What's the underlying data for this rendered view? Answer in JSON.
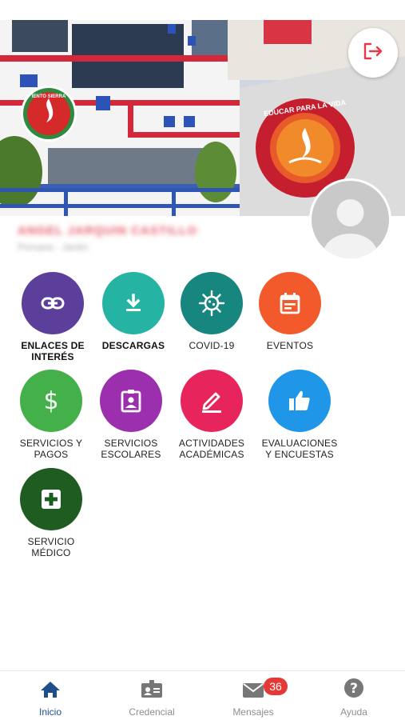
{
  "profile": {
    "name": "ANGEL JARQUIN CASTILLO",
    "level": "Primaria - Jardín"
  },
  "hero": {
    "badge_text": "EDUCAR PARA LA VIDA",
    "logo_text": "IENTO SIERRA"
  },
  "tiles": [
    {
      "label": "ENLACES DE\nINTERÉS",
      "color": "#5b3f9a",
      "icon": "link-icon"
    },
    {
      "label": "DESCARGAS",
      "color": "#25b3a3",
      "icon": "download-icon"
    },
    {
      "label": "COVID-19",
      "color": "#16867f",
      "icon": "virus-icon"
    },
    {
      "label": "EVENTOS",
      "color": "#f2592b",
      "icon": "calendar-icon"
    },
    {
      "label": "SERVICIOS Y\nPAGOS",
      "color": "#43b04a",
      "icon": "dollar-icon"
    },
    {
      "label": "SERVICIOS\nESCOLARES",
      "color": "#9b2fae",
      "icon": "id-badge-icon"
    },
    {
      "label": "ACTIVIDADES\nACADÉMICAS",
      "color": "#e8245c",
      "icon": "pencil-icon"
    },
    {
      "label": "EVALUACIONES\nY ENCUESTAS",
      "color": "#1f96e8",
      "icon": "thumbs-up-icon"
    },
    {
      "label": "SERVICIO\nMÉDICO",
      "color": "#1f5c22",
      "icon": "medical-plus-icon"
    }
  ],
  "nav": {
    "items": [
      {
        "label": "Inicio",
        "icon": "home-icon",
        "active": true
      },
      {
        "label": "Credencial",
        "icon": "id-card-icon",
        "active": false
      },
      {
        "label": "Mensajes",
        "icon": "mail-icon",
        "active": false,
        "badge": "36"
      },
      {
        "label": "Ayuda",
        "icon": "help-icon",
        "active": false
      }
    ]
  },
  "colors": {
    "active_nav": "#1f4e8c",
    "inactive_nav": "#8e8e8e",
    "badge": "#e53935",
    "logout_icon": "#e5394a"
  }
}
